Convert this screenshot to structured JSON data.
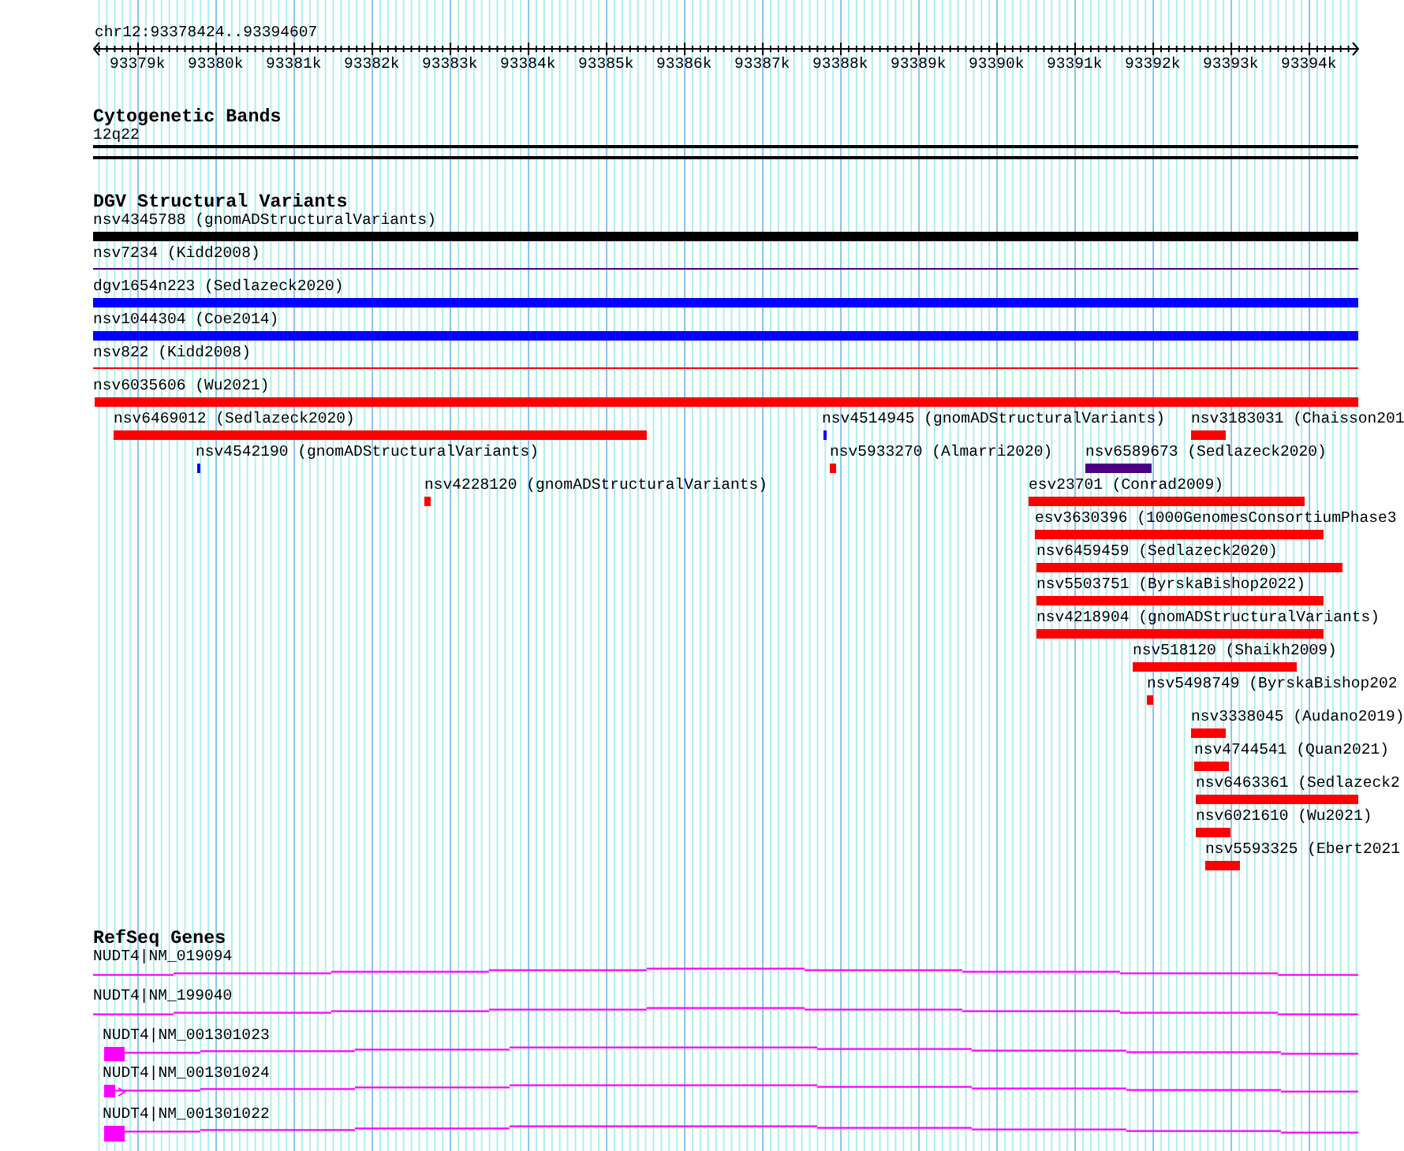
{
  "ruler": {
    "location": "chr12:93378424..93394607",
    "ticks": [
      "93379k",
      "93380k",
      "93381k",
      "93382k",
      "93383k",
      "93384k",
      "93385k",
      "93386k",
      "93387k",
      "93388k",
      "93389k",
      "93390k",
      "93391k",
      "93392k",
      "93393k",
      "93394k"
    ]
  },
  "cytogenetic_bands": {
    "title": "Cytogenetic Bands",
    "band": "12q22"
  },
  "dgv": {
    "title": "DGV Structural Variants",
    "features": [
      {
        "label": "nsv4345788 (gnomADStructuralVariants)",
        "kind": "bar",
        "color": "#000000"
      },
      {
        "label": "nsv7234 (Kidd2008)",
        "kind": "line",
        "color": "#4b0082"
      },
      {
        "label": "dgv1654n223 (Sedlazeck2020)",
        "kind": "bar",
        "color": "#0000ff"
      },
      {
        "label": "nsv1044304 (Coe2014)",
        "kind": "bar",
        "color": "#0000ff"
      },
      {
        "label": "nsv822 (Kidd2008)",
        "kind": "line",
        "color": "#ff0000"
      },
      {
        "label": "nsv6035606 (Wu2021)",
        "kind": "bar",
        "color": "#ff0000"
      },
      {
        "label": "nsv6469012 (Sedlazeck2020)",
        "kind": "bar",
        "color": "#ff0000"
      },
      {
        "label": "nsv4514945 (gnomADStructuralVariants)",
        "kind": "bar",
        "color": "#0000ff"
      },
      {
        "label": "nsv3183031 (Chaisson201",
        "kind": "bar",
        "color": "#ff0000"
      },
      {
        "label": "nsv4542190 (gnomADStructuralVariants)",
        "kind": "bar",
        "color": "#0000ff"
      },
      {
        "label": "nsv5933270 (Almarri2020)",
        "kind": "bar",
        "color": "#ff0000"
      },
      {
        "label": "nsv6589673 (Sedlazeck2020)",
        "kind": "bar",
        "color": "#4b0082"
      },
      {
        "label": "nsv4228120 (gnomADStructuralVariants)",
        "kind": "bar",
        "color": "#ff0000"
      },
      {
        "label": "esv23701 (Conrad2009)",
        "kind": "bar",
        "color": "#ff0000"
      },
      {
        "label": "esv3630396 (1000GenomesConsortiumPhase3",
        "kind": "bar",
        "color": "#ff0000"
      },
      {
        "label": "nsv6459459 (Sedlazeck2020)",
        "kind": "bar",
        "color": "#ff0000"
      },
      {
        "label": "nsv5503751 (ByrskaBishop2022)",
        "kind": "bar",
        "color": "#ff0000"
      },
      {
        "label": "nsv4218904 (gnomADStructuralVariants)",
        "kind": "bar",
        "color": "#ff0000"
      },
      {
        "label": "nsv518120 (Shaikh2009)",
        "kind": "bar",
        "color": "#ff0000"
      },
      {
        "label": "nsv5498749 (ByrskaBishop202",
        "kind": "bar",
        "color": "#ff0000"
      },
      {
        "label": "nsv3338045 (Audano2019)",
        "kind": "bar",
        "color": "#ff0000"
      },
      {
        "label": "nsv4744541 (Quan2021)",
        "kind": "bar",
        "color": "#ff0000"
      },
      {
        "label": "nsv6463361 (Sedlazeck2",
        "kind": "bar",
        "color": "#ff0000"
      },
      {
        "label": "nsv6021610 (Wu2021)",
        "kind": "bar",
        "color": "#ff0000"
      },
      {
        "label": "nsv5593325 (Ebert2021",
        "kind": "bar",
        "color": "#ff0000"
      }
    ]
  },
  "refseq_genes": {
    "title": "RefSeq Genes",
    "transcripts": [
      {
        "label": "NUDT4|NM_019094"
      },
      {
        "label": "NUDT4|NM_199040"
      },
      {
        "label": "NUDT4|NM_001301023"
      },
      {
        "label": "NUDT4|NM_001301024"
      },
      {
        "label": "NUDT4|NM_001301022"
      }
    ]
  }
}
